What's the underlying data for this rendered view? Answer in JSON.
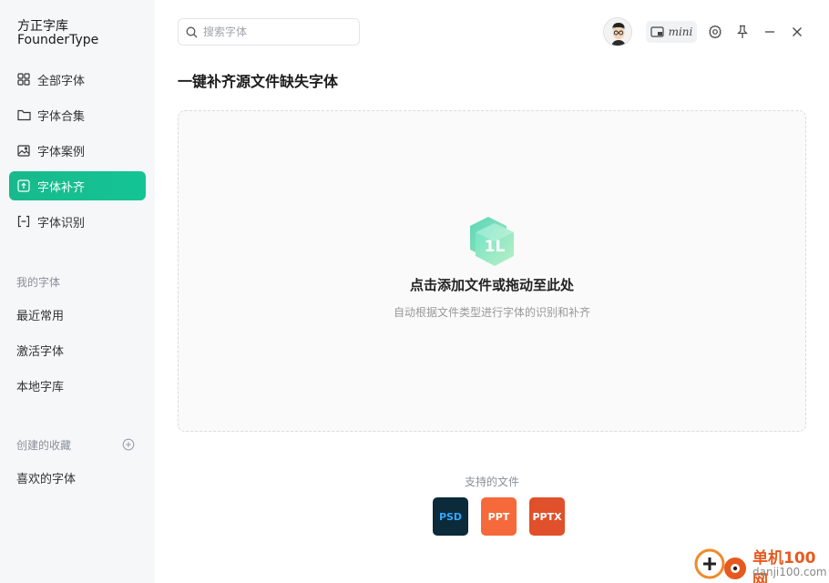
{
  "brand": {
    "line1": "方正字库",
    "line2": "FounderType"
  },
  "nav": {
    "items": [
      {
        "label": "全部字体",
        "icon": "grid-icon"
      },
      {
        "label": "字体合集",
        "icon": "folder-icon"
      },
      {
        "label": "字体案例",
        "icon": "image-icon"
      },
      {
        "label": "字体补齐",
        "icon": "upload-box-icon",
        "active": true
      },
      {
        "label": "字体识别",
        "icon": "scan-icon"
      }
    ]
  },
  "my_fonts": {
    "title": "我的字体",
    "items": [
      "最近常用",
      "激活字体",
      "本地字库"
    ]
  },
  "collections": {
    "title": "创建的收藏",
    "items": [
      "喜欢的字体"
    ]
  },
  "search": {
    "placeholder": "搜索字体",
    "value": ""
  },
  "toolbar": {
    "mini_label": "mini"
  },
  "page": {
    "title": "一键补齐源文件缺失字体"
  },
  "dropzone": {
    "title": "点击添加文件或拖动至此处",
    "subtitle": "自动根据文件类型进行字体的识别和补齐"
  },
  "supported": {
    "title": "支持的文件",
    "types": [
      {
        "label": "PSD",
        "color": "#0b2a3a",
        "text_color": "#31a8ff"
      },
      {
        "label": "PPT",
        "color": "#f5693a",
        "text_color": "#ffffff"
      },
      {
        "label": "PPTX",
        "color": "#e0502a",
        "text_color": "#ffffff"
      }
    ]
  },
  "watermark": {
    "text1": "单机100网",
    "text2": "danji100.com"
  },
  "colors": {
    "accent": "#18b98c"
  }
}
